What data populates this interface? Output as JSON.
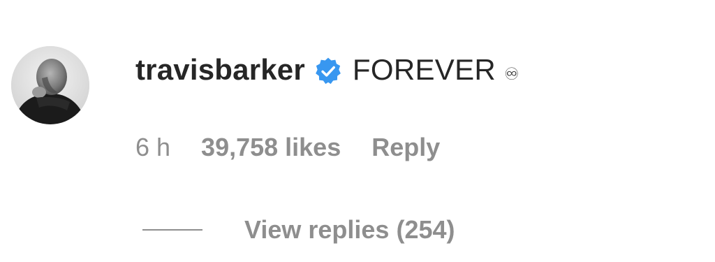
{
  "comment": {
    "username": "travisbarker",
    "verified_icon": "verified-badge-icon",
    "text": "FOREVER",
    "emoji": "♾",
    "timestamp": "6 h",
    "likes": "39,758 likes",
    "reply_label": "Reply",
    "view_replies_label": "View replies (254)"
  },
  "colors": {
    "text_primary": "#262626",
    "text_secondary": "#8e8e8e",
    "verified_blue": "#3897f0"
  }
}
